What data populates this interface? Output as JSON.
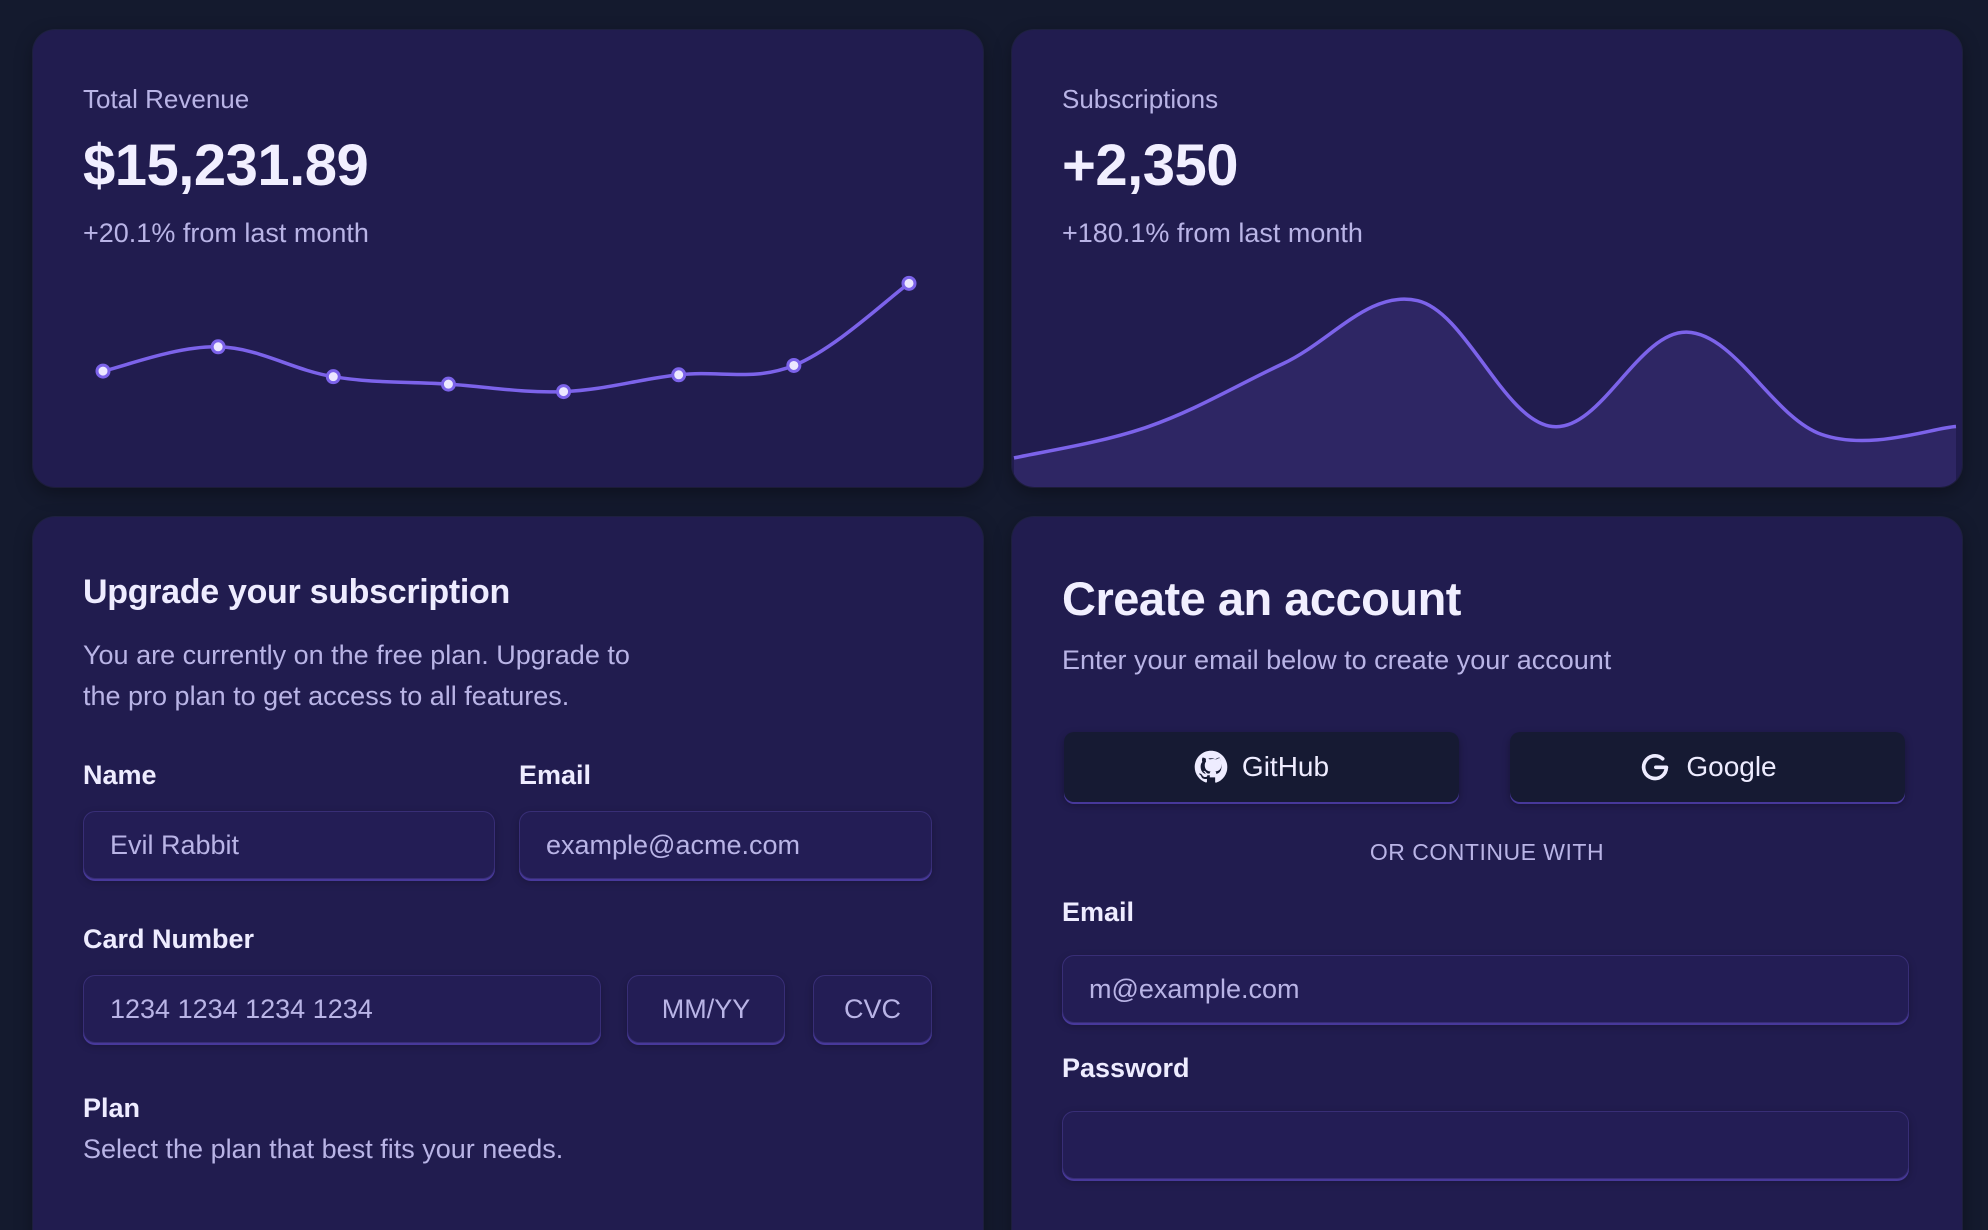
{
  "revenue": {
    "label": "Total Revenue",
    "value": "$15,231.89",
    "change": "+20.1% from last month"
  },
  "subscriptions": {
    "label": "Subscriptions",
    "value": "+2,350",
    "change": "+180.1% from last month"
  },
  "upgrade": {
    "title": "Upgrade your subscription",
    "description": "You are currently on the free plan. Upgrade to the pro plan to get access to all features.",
    "name_label": "Name",
    "name_value": "Evil Rabbit",
    "email_label": "Email",
    "email_placeholder": "example@acme.com",
    "card_label": "Card Number",
    "card_placeholder": "1234 1234 1234 1234",
    "expiry_placeholder": "MM/YY",
    "cvc_placeholder": "CVC",
    "plan_label": "Plan",
    "plan_description": "Select the plan that best fits your needs."
  },
  "account": {
    "title": "Create an account",
    "description": "Enter your email below to create your account",
    "github_label": "GitHub",
    "google_label": "Google",
    "divider": "OR CONTINUE WITH",
    "email_label": "Email",
    "email_placeholder": "m@example.com",
    "password_label": "Password",
    "password_value": ""
  },
  "icons": {
    "github": "github-icon",
    "google": "google-icon"
  },
  "colors": {
    "accent": "#7c63ea",
    "card_bg": "#211c4f",
    "page_bg": "#141a2e"
  },
  "chart_data": [
    {
      "type": "line",
      "x": [
        1,
        2,
        3,
        4,
        5,
        6,
        7,
        8
      ],
      "series": [
        {
          "values": [
            0.53,
            0.66,
            0.5,
            0.46,
            0.42,
            0.51,
            0.56,
            1.0
          ]
        }
      ],
      "markers": true,
      "ylim": [
        0,
        1.2
      ],
      "grid": false
    },
    {
      "type": "area",
      "x": [
        0,
        1,
        2,
        3,
        4,
        5,
        6,
        7
      ],
      "series": [
        {
          "values": [
            0.0,
            0.2,
            0.6,
            1.0,
            0.2,
            0.8,
            0.15,
            0.2
          ]
        }
      ],
      "ylim": [
        0,
        1.1
      ],
      "grid": false
    }
  ]
}
